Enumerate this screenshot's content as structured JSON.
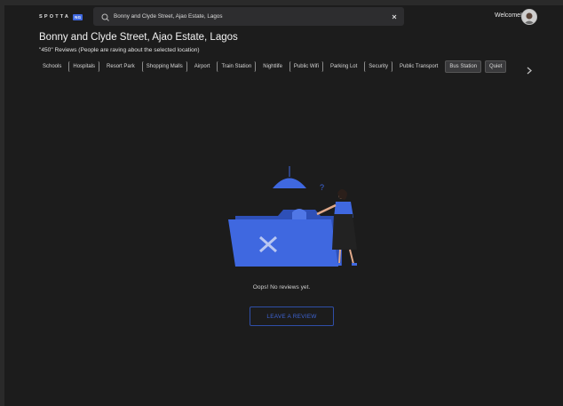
{
  "header": {
    "logo_text": "SPOTTA",
    "logo_badge": "NG",
    "search": {
      "value": "Bonny and Clyde Street, Ajao Estate, Lagos",
      "icon": "search-icon",
      "clear_icon": "close-icon"
    },
    "welcome": "Welcome!",
    "avatar_icon": "user-avatar"
  },
  "location": {
    "title": "Bonny and Clyde Street, Ajao Estate, Lagos",
    "reviews_summary": "\"450\" Reviews (People are raving about the selected location)"
  },
  "tags": [
    "Schools",
    "Hospitals",
    "Resort Park",
    "Shopping Malls",
    "Airport",
    "Train Station",
    "Nightlife",
    "Public Wifi",
    "Parking Lot",
    "Security",
    "Public Transport",
    "Bus Station",
    "Quiet"
  ],
  "empty_state": {
    "message": "Oops! No reviews yet.",
    "button_label": "LEAVE A REVIEW"
  },
  "colors": {
    "accent": "#3f68e0",
    "background": "#1c1c1c"
  }
}
